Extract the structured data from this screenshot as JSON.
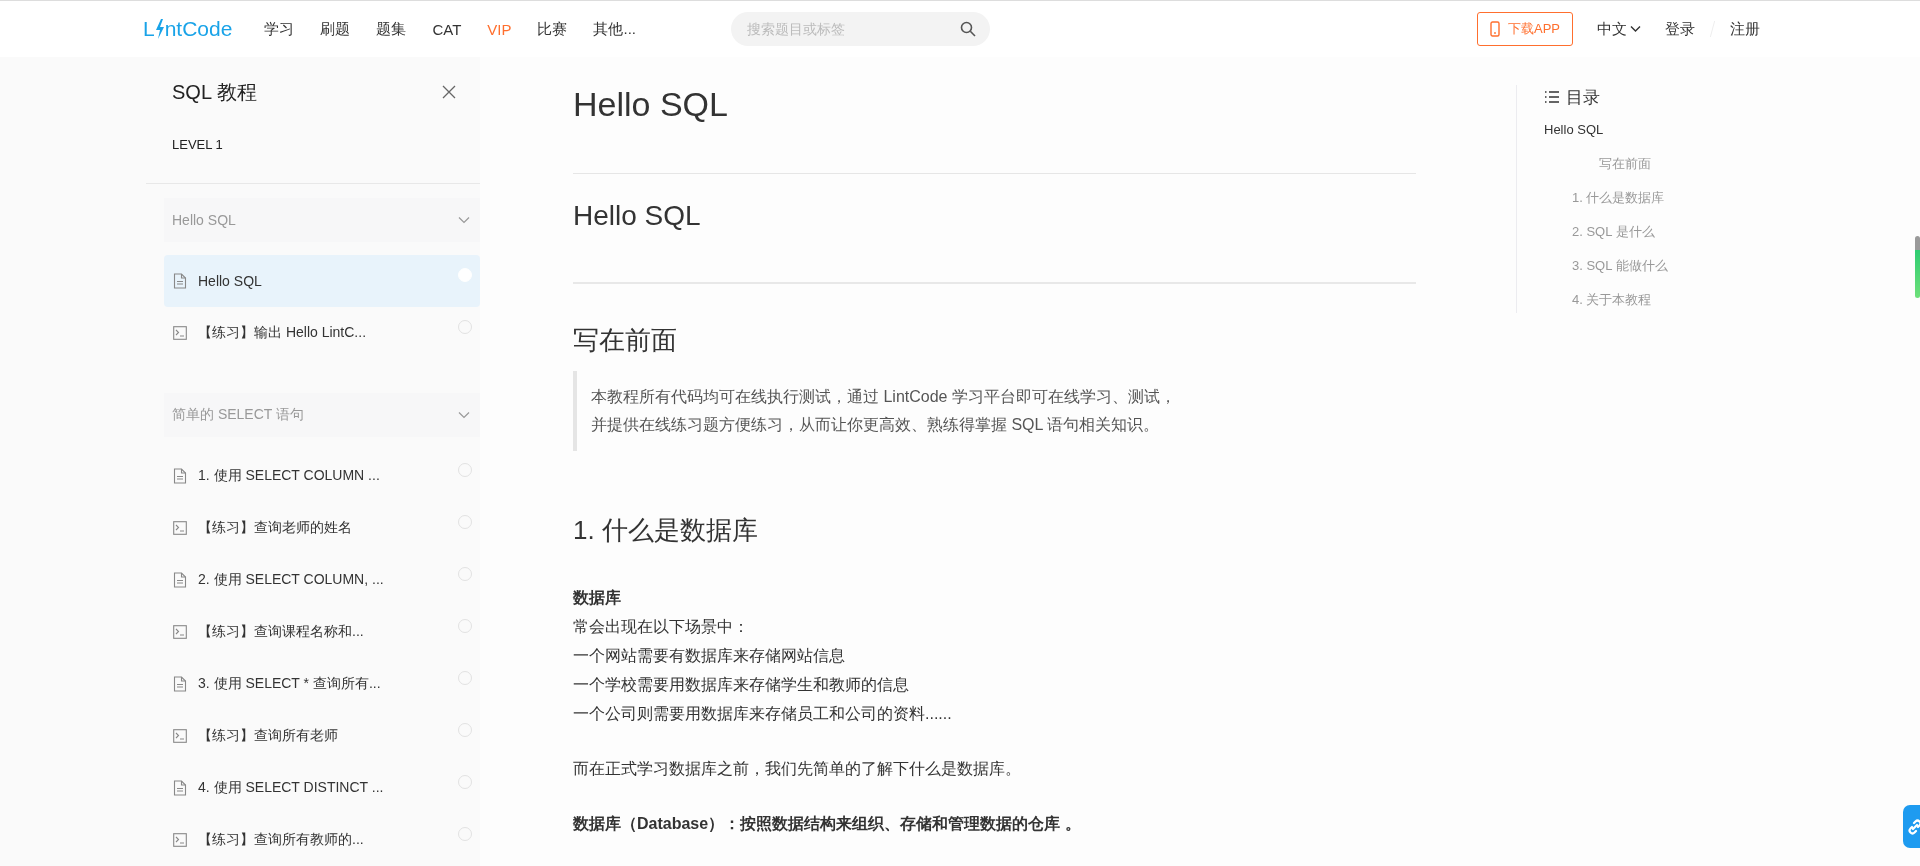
{
  "header": {
    "logo": {
      "before": "L",
      "after": "ntCode"
    },
    "nav": [
      {
        "label": "学习",
        "highlighted": false
      },
      {
        "label": "刷题",
        "highlighted": false
      },
      {
        "label": "题集",
        "highlighted": false
      },
      {
        "label": "CAT",
        "highlighted": false
      },
      {
        "label": "VIP",
        "highlighted": true
      },
      {
        "label": "比赛",
        "highlighted": false
      },
      {
        "label": "其他...",
        "highlighted": false
      }
    ],
    "search": {
      "placeholder": "搜索题目或标签"
    },
    "download_button": "下载APP",
    "language": "中文",
    "login": "登录",
    "register": "注册"
  },
  "sidebar": {
    "title": "SQL 教程",
    "level": "LEVEL 1",
    "groups": [
      {
        "title": "Hello SQL",
        "expanded": true,
        "items": [
          {
            "kind": "doc",
            "label": "Hello SQL",
            "selected": true
          },
          {
            "kind": "exercise",
            "label": "【练习】输出 Hello LintC...",
            "selected": false
          }
        ]
      },
      {
        "title": "简单的 SELECT 语句",
        "expanded": true,
        "items": [
          {
            "kind": "doc",
            "label": "1. 使用 SELECT COLUMN ...",
            "selected": false
          },
          {
            "kind": "exercise",
            "label": "【练习】查询老师的姓名",
            "selected": false
          },
          {
            "kind": "doc",
            "label": "2. 使用 SELECT COLUMN, ...",
            "selected": false
          },
          {
            "kind": "exercise",
            "label": "【练习】查询课程名称和...",
            "selected": false
          },
          {
            "kind": "doc",
            "label": "3. 使用 SELECT * 查询所有...",
            "selected": false
          },
          {
            "kind": "exercise",
            "label": "【练习】查询所有老师",
            "selected": false
          },
          {
            "kind": "doc",
            "label": "4. 使用 SELECT DISTINCT ...",
            "selected": false
          },
          {
            "kind": "exercise",
            "label": "【练习】查询所有教师的...",
            "selected": false
          }
        ]
      }
    ]
  },
  "article": {
    "blocks": [
      {
        "kind": "h1",
        "text": "Hello SQL"
      },
      {
        "kind": "rule"
      },
      {
        "kind": "h2",
        "text": "Hello SQL"
      },
      {
        "kind": "rule"
      },
      {
        "kind": "h3",
        "text": "写在前面"
      },
      {
        "kind": "quote",
        "lines": [
          "本教程所有代码均可在线执行测试，通过 LintCode 学习平台即可在线学习、测试，",
          "并提供在线练习题方便练习，从而让你更高效、熟练得掌握 SQL 语句相关知识。"
        ]
      },
      {
        "kind": "h3",
        "text": "1. 什么是数据库"
      },
      {
        "kind": "para",
        "heading": "数据库",
        "lines": [
          "常会出现在以下场景中：",
          "一个网站需要有数据库来存储网站信息",
          "一个学校需要用数据库来存储学生和教师的信息",
          "一个公司则需要用数据库来存储员工和公司的资料......"
        ]
      },
      {
        "kind": "para",
        "lines": [
          "而在正式学习数据库之前，我们先简单的了解下什么是数据库。"
        ]
      },
      {
        "kind": "strong",
        "text": "数据库（Database）：按照数据结构来组织、存储和管理数据的仓库 。"
      }
    ]
  },
  "toc": {
    "title": "目录",
    "items": [
      {
        "label": "Hello SQL",
        "selected": true,
        "kind": "heading",
        "children": [
          {
            "label": "写在前面",
            "selected": false,
            "kind": "intro"
          },
          {
            "label": "1. 什么是数据库",
            "selected": false,
            "kind": "heading"
          },
          {
            "label": "2. SQL 是什么",
            "selected": false,
            "kind": "heading"
          },
          {
            "label": "3. SQL 能做什么",
            "selected": false,
            "kind": "heading"
          },
          {
            "label": "4. 关于本教程",
            "selected": false,
            "kind": "heading"
          }
        ]
      }
    ]
  }
}
